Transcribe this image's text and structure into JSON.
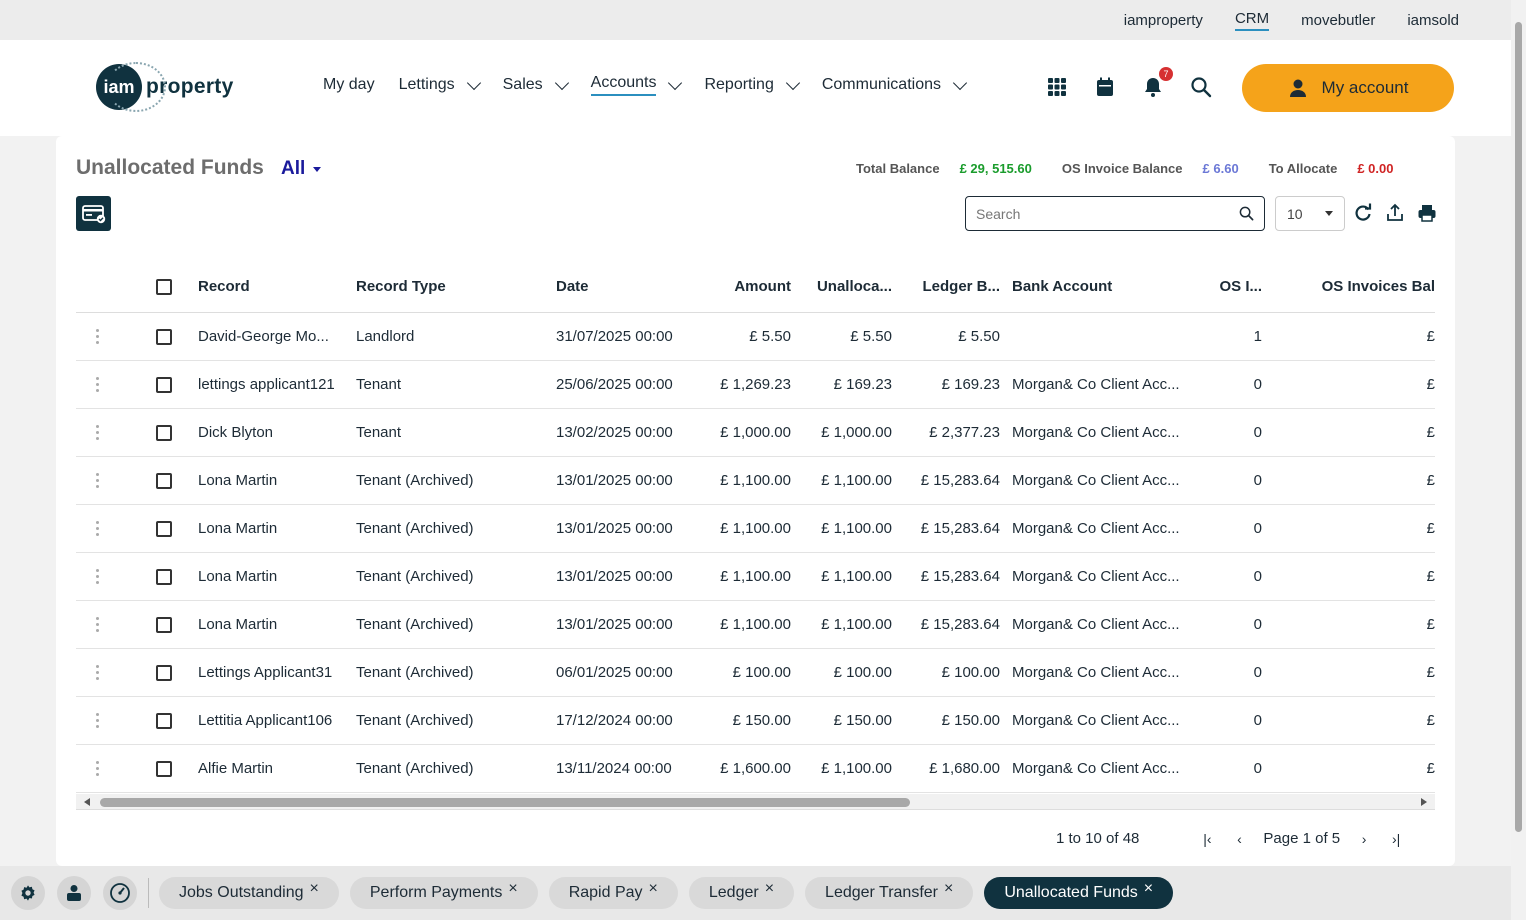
{
  "topbar": {
    "links": [
      "iamproperty",
      "CRM",
      "movebutler",
      "iamsold"
    ],
    "active": "CRM"
  },
  "logo": {
    "mark": "iam",
    "word": "property"
  },
  "nav": {
    "items": [
      {
        "label": "My day",
        "dropdown": false
      },
      {
        "label": "Lettings",
        "dropdown": true
      },
      {
        "label": "Sales",
        "dropdown": true
      },
      {
        "label": "Accounts",
        "dropdown": true,
        "active": true
      },
      {
        "label": "Reporting",
        "dropdown": true
      },
      {
        "label": "Communications",
        "dropdown": true
      }
    ]
  },
  "header_icons": [
    "apps-grid-icon",
    "calendar-icon",
    "bell-icon",
    "search-icon"
  ],
  "notifications": {
    "count": "7"
  },
  "my_account": {
    "label": "My account"
  },
  "page": {
    "title": "Unallocated Funds",
    "filter": "All",
    "balances": {
      "total_label": "Total Balance",
      "total_value": "£ 29, 515.60",
      "os_label": "OS Invoice Balance",
      "os_value": "£ 6.60",
      "alloc_label": "To Allocate",
      "alloc_value": "£ 0.00"
    },
    "colors": {
      "green": "#1a9c2c",
      "blue": "#6b78d6",
      "red": "#d02424",
      "accent": "#f5a31a",
      "dark": "#10323f"
    }
  },
  "toolbar": {
    "search_placeholder": "Search",
    "page_size": "10"
  },
  "table": {
    "columns": [
      "Record",
      "Record Type",
      "Date",
      "Amount",
      "Unalloca...",
      "Ledger B...",
      "Bank Account",
      "OS I...",
      "OS Invoices Bal"
    ],
    "rows": [
      {
        "record": "David-George Mo...",
        "type": "Landlord",
        "date": "31/07/2025 00:00",
        "amount": "£ 5.50",
        "unallocated": "£ 5.50",
        "ledger": "£ 5.50",
        "bank": "",
        "os_invoices": "1",
        "os_bal": "£"
      },
      {
        "record": "lettings applicant121",
        "type": "Tenant",
        "date": "25/06/2025 00:00",
        "amount": "£ 1,269.23",
        "unallocated": "£ 169.23",
        "ledger": "£ 169.23",
        "bank": "Morgan& Co Client Acc...",
        "os_invoices": "0",
        "os_bal": "£"
      },
      {
        "record": "Dick Blyton",
        "type": "Tenant",
        "date": "13/02/2025 00:00",
        "amount": "£ 1,000.00",
        "unallocated": "£ 1,000.00",
        "ledger": "£ 2,377.23",
        "bank": "Morgan& Co Client Acc...",
        "os_invoices": "0",
        "os_bal": "£"
      },
      {
        "record": "Lona Martin",
        "type": "Tenant (Archived)",
        "date": "13/01/2025 00:00",
        "amount": "£ 1,100.00",
        "unallocated": "£ 1,100.00",
        "ledger": "£ 15,283.64",
        "bank": "Morgan& Co Client Acc...",
        "os_invoices": "0",
        "os_bal": "£"
      },
      {
        "record": "Lona Martin",
        "type": "Tenant (Archived)",
        "date": "13/01/2025 00:00",
        "amount": "£ 1,100.00",
        "unallocated": "£ 1,100.00",
        "ledger": "£ 15,283.64",
        "bank": "Morgan& Co Client Acc...",
        "os_invoices": "0",
        "os_bal": "£"
      },
      {
        "record": "Lona Martin",
        "type": "Tenant (Archived)",
        "date": "13/01/2025 00:00",
        "amount": "£ 1,100.00",
        "unallocated": "£ 1,100.00",
        "ledger": "£ 15,283.64",
        "bank": "Morgan& Co Client Acc...",
        "os_invoices": "0",
        "os_bal": "£"
      },
      {
        "record": "Lona Martin",
        "type": "Tenant (Archived)",
        "date": "13/01/2025 00:00",
        "amount": "£ 1,100.00",
        "unallocated": "£ 1,100.00",
        "ledger": "£ 15,283.64",
        "bank": "Morgan& Co Client Acc...",
        "os_invoices": "0",
        "os_bal": "£"
      },
      {
        "record": "Lettings Applicant31",
        "type": "Tenant (Archived)",
        "date": "06/01/2025 00:00",
        "amount": "£ 100.00",
        "unallocated": "£ 100.00",
        "ledger": "£ 100.00",
        "bank": "Morgan& Co Client Acc...",
        "os_invoices": "0",
        "os_bal": "£"
      },
      {
        "record": "Lettitia Applicant106",
        "type": "Tenant (Archived)",
        "date": "17/12/2024 00:00",
        "amount": "£ 150.00",
        "unallocated": "£ 150.00",
        "ledger": "£ 150.00",
        "bank": "Morgan& Co Client Acc...",
        "os_invoices": "0",
        "os_bal": "£"
      },
      {
        "record": "Alfie Martin",
        "type": "Tenant (Archived)",
        "date": "13/11/2024 00:00",
        "amount": "£ 1,600.00",
        "unallocated": "£ 1,100.00",
        "ledger": "£ 1,680.00",
        "bank": "Morgan& Co Client Acc...",
        "os_invoices": "0",
        "os_bal": "£"
      }
    ]
  },
  "pagination": {
    "range": "1 to 10 of 48",
    "page": "Page 1 of 5"
  },
  "bottom": {
    "icons": [
      "gear-icon",
      "users-icon",
      "gauge-icon"
    ],
    "tabs": [
      {
        "label": "Jobs Outstanding",
        "active": false
      },
      {
        "label": "Perform Payments",
        "active": false
      },
      {
        "label": "Rapid Pay",
        "active": false
      },
      {
        "label": "Ledger",
        "active": false
      },
      {
        "label": "Ledger Transfer",
        "active": false
      },
      {
        "label": "Unallocated Funds",
        "active": true
      }
    ],
    "close_glyph": "×"
  }
}
